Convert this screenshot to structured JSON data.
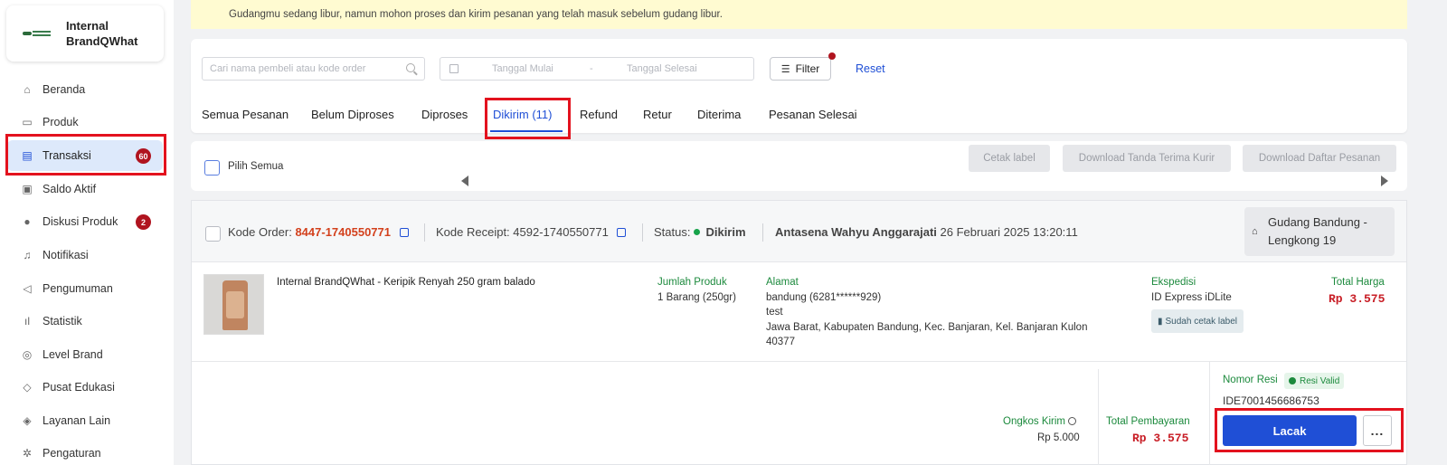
{
  "brand": {
    "name": "Internal BrandQWhat"
  },
  "sidebar": {
    "items": [
      {
        "label": "Beranda",
        "icon": "home-icon"
      },
      {
        "label": "Produk",
        "icon": "box-icon"
      },
      {
        "label": "Transaksi",
        "icon": "receipt-icon",
        "badge": "60",
        "active": true
      },
      {
        "label": "Saldo Aktif",
        "icon": "wallet-icon"
      },
      {
        "label": "Diskusi Produk",
        "icon": "chat-icon",
        "badge": "2"
      },
      {
        "label": "Notifikasi",
        "icon": "bell-icon"
      },
      {
        "label": "Pengumuman",
        "icon": "megaphone-icon"
      },
      {
        "label": "Statistik",
        "icon": "bar-chart-icon"
      },
      {
        "label": "Level Brand",
        "icon": "medal-icon"
      },
      {
        "label": "Pusat Edukasi",
        "icon": "graduation-cap-icon"
      },
      {
        "label": "Layanan Lain",
        "icon": "tag-icon"
      },
      {
        "label": "Pengaturan",
        "icon": "gear-icon"
      }
    ]
  },
  "notice": {
    "text": "Gudangmu sedang libur, namun mohon proses dan kirim pesanan yang telah masuk sebelum gudang libur."
  },
  "filters": {
    "search_placeholder": "Cari nama pembeli atau kode order",
    "date_start_placeholder": "Tanggal Mulai",
    "date_separator": "-",
    "date_end_placeholder": "Tanggal Selesai",
    "filter_label": "Filter",
    "reset_label": "Reset"
  },
  "tabs": [
    {
      "label": "Semua Pesanan"
    },
    {
      "label": "Belum Diproses"
    },
    {
      "label": "Diproses"
    },
    {
      "label": "Dikirim (11)",
      "active": true
    },
    {
      "label": "Refund"
    },
    {
      "label": "Retur"
    },
    {
      "label": "Diterima"
    },
    {
      "label": "Pesanan Selesai"
    }
  ],
  "bulk": {
    "select_all": "Pilih Semua",
    "cetak_label": "Cetak label",
    "download_tanda_terima": "Download Tanda Terima Kurir",
    "download_daftar": "Download Daftar Pesanan"
  },
  "order": {
    "kode_order_label": "Kode Order:",
    "kode_order": "8447-1740550771",
    "kode_receipt_label": "Kode Receipt:",
    "kode_receipt": "4592-1740550771",
    "status_label": "Status:",
    "status": "Dikirim",
    "buyer": "Antasena Wahyu Anggarajati",
    "date": "26 Februari 2025 13:20:11",
    "warehouse": "Gudang Bandung - Lengkong 19",
    "product_name": "Internal BrandQWhat - Keripik Renyah 250 gram balado",
    "jumlah_label": "Jumlah Produk",
    "jumlah_value": "1 Barang (250gr)",
    "alamat_label": "Alamat",
    "alamat_lines": [
      "bandung (6281******929)",
      "test",
      "Jawa Barat, Kabupaten Bandung, Kec. Banjaran, Kel. Banjaran Kulon",
      "40377"
    ],
    "ekspedisi_label": "Ekspedisi",
    "ekspedisi_value": "ID Express iDLite",
    "cetak_status": "Sudah cetak label",
    "total_harga_label": "Total Harga",
    "total_harga": "Rp 3.575",
    "ongkos_label": "Ongkos Kirim",
    "ongkos_value": "Rp 5.000",
    "total_bayar_label": "Total Pembayaran",
    "total_bayar": "Rp 3.575",
    "nomor_resi_label": "Nomor Resi",
    "resi_status": "Resi Valid",
    "nomor_resi": "IDE7001456686753",
    "lacak_label": "Lacak",
    "more_label": "..."
  },
  "colors": {
    "accent": "#1f4fd6",
    "badge": "#b0141f",
    "highlight": "#e3121e",
    "price": "#c81d25",
    "green": "#1c8a3d"
  }
}
